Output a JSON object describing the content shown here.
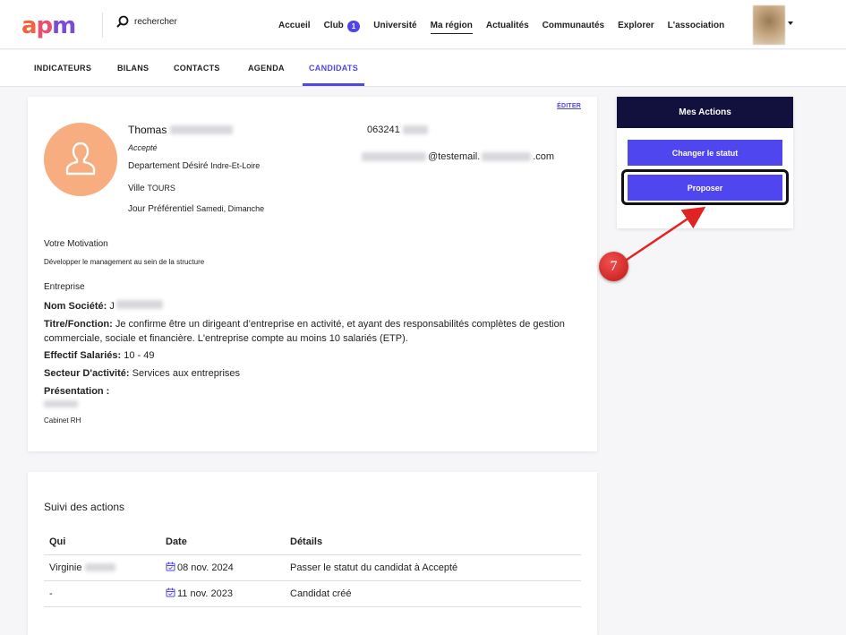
{
  "brand": {
    "logo_a": "a",
    "logo_p": "p",
    "logo_m": "m"
  },
  "search": {
    "placeholder": "rechercher"
  },
  "nav": {
    "items": [
      "Accueil",
      "Club",
      "Université",
      "Ma région",
      "Actualités",
      "Communautés",
      "Explorer",
      "L'association"
    ],
    "club_badge": "1",
    "active": "Ma région"
  },
  "subtabs": [
    "INDICATEURS",
    "BILANS",
    "CONTACTS",
    "AGENDA",
    "CANDIDATS"
  ],
  "active_subtab": "CANDIDATS",
  "profile": {
    "edit_label": "ÉDITER",
    "first_name": "Thomas",
    "status": "Accepté",
    "dept_label": "Departement Désiré",
    "dept_value": "Indre-Et-Loire",
    "city_label": "Ville",
    "city_value": "TOURS",
    "day_label": "Jour Préférentiel",
    "day_value": "Samedi, Dimanche",
    "phone_prefix": "063241",
    "email_middle": "@testemail.",
    "email_suffix": ".com",
    "motivation_title": "Votre Motivation",
    "motivation_text": "Développer le management au sein de la structure",
    "company_title": "Entreprise",
    "company_name_label": "Nom Société:",
    "company_name_value": "J",
    "job_label": "Titre/Fonction:",
    "job_value": "Je confirme être un dirigeant d’entreprise en activité, et ayant des responsabilités complètes de gestion commerciale, sociale et financière. L'entreprise compte au moins 10 salariés (ETP).",
    "staff_label": "Effectif Salariés:",
    "staff_value": "10 - 49",
    "sector_label": "Secteur D'activité:",
    "sector_value": "Services aux entreprises",
    "presentation_label": "Présentation :",
    "presentation_text": "Cabinet RH"
  },
  "actions_panel": {
    "title": "Mes Actions",
    "change_status": "Changer le statut",
    "propose": "Proposer"
  },
  "suivi": {
    "title": "Suivi des actions",
    "headers": [
      "Qui",
      "Date",
      "Détails"
    ],
    "rows": [
      {
        "who": "Virginie",
        "date": "08 nov. 2024",
        "details": "Passer le statut du candidat à Accepté"
      },
      {
        "who": "-",
        "date": "11 nov. 2023",
        "details": "Candidat créé"
      }
    ]
  },
  "annotation": {
    "step": "7"
  },
  "colors": {
    "accent": "#5046e5",
    "header_dark": "#12103c",
    "avatar_bg": "#f7ad80",
    "marker": "#d32222"
  }
}
